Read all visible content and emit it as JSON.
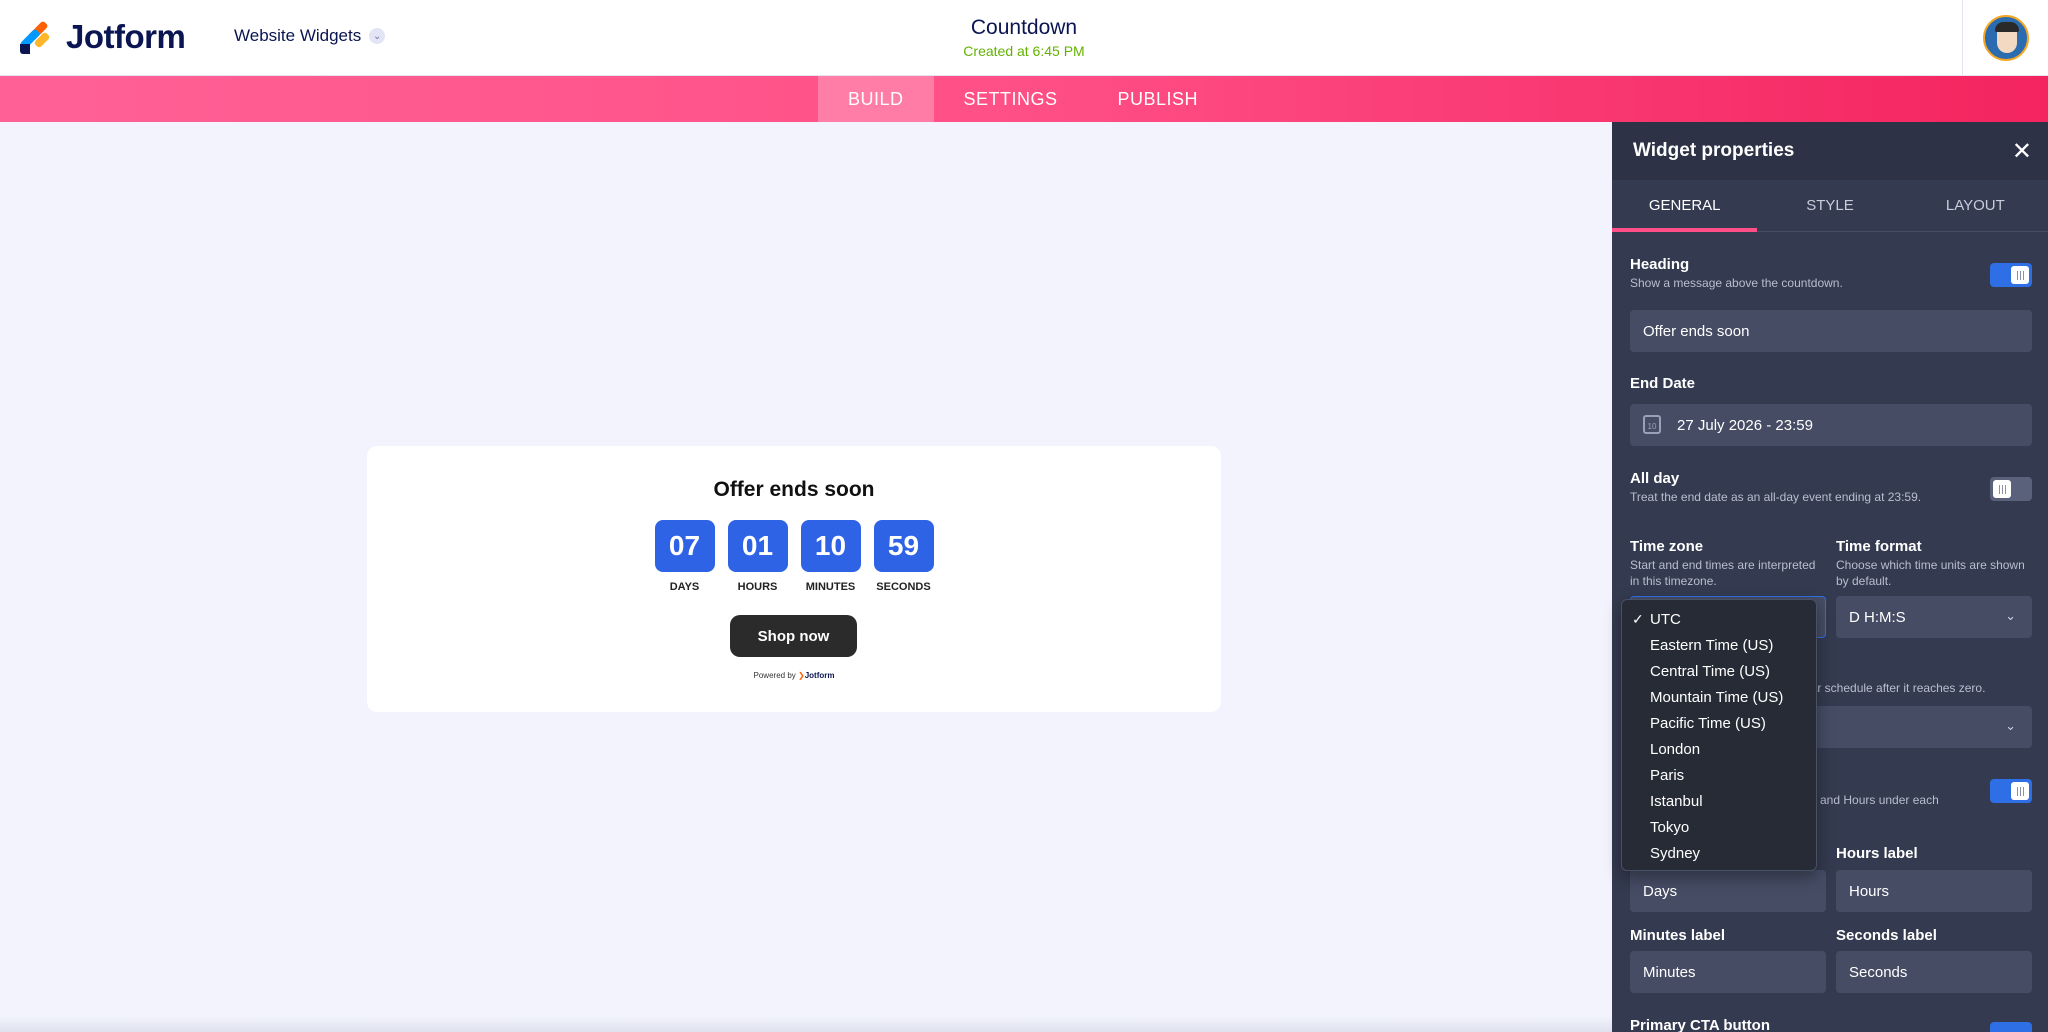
{
  "header": {
    "logo_text": "Jotform",
    "workspace": "Website Widgets",
    "title": "Countdown",
    "subtitle": "Created at 6:45 PM"
  },
  "nav": {
    "tabs": [
      "BUILD",
      "SETTINGS",
      "PUBLISH"
    ],
    "active": "BUILD"
  },
  "widget": {
    "heading": "Offer ends soon",
    "units": [
      {
        "value": "07",
        "label": "DAYS"
      },
      {
        "value": "01",
        "label": "HOURS"
      },
      {
        "value": "10",
        "label": "MINUTES"
      },
      {
        "value": "59",
        "label": "SECONDS"
      }
    ],
    "cta": "Shop now",
    "powered_prefix": "Powered by",
    "powered_brand": "Jotform",
    "accent_color": "#2e63e6"
  },
  "panel": {
    "title": "Widget properties",
    "tabs": [
      "GENERAL",
      "STYLE",
      "LAYOUT"
    ],
    "active_tab": "GENERAL",
    "heading": {
      "label": "Heading",
      "desc": "Show a message above the countdown.",
      "value": "Offer ends soon",
      "toggle": "on"
    },
    "end_date": {
      "label": "End Date",
      "value": "27 July 2026 - 23:59"
    },
    "all_day": {
      "label": "All day",
      "desc": "Treat the end date as an all-day event ending at 23:59.",
      "toggle": "off"
    },
    "time_zone": {
      "label": "Time zone",
      "desc": "Start and end times are interpreted in this timezone."
    },
    "time_format": {
      "label": "Time format",
      "desc": "Choose which time units are shown by default.",
      "value": "D H:M:S"
    },
    "repeat_desc_fragment": "lar schedule after it reaches zero.",
    "labels_desc_fragment": "and Hours under each",
    "days_label": {
      "label": "Days label",
      "value": "Days"
    },
    "hours_label": {
      "label": "Hours label",
      "value": "Hours"
    },
    "minutes_label": {
      "label": "Minutes label",
      "value": "Minutes"
    },
    "seconds_label": {
      "label": "Seconds label",
      "value": "Seconds"
    },
    "primary_cta": {
      "label": "Primary CTA button"
    }
  },
  "timezone_dropdown": {
    "selected": "UTC",
    "options": [
      "UTC",
      "Eastern Time (US)",
      "Central Time (US)",
      "Mountain Time (US)",
      "Pacific Time (US)",
      "London",
      "Paris",
      "Istanbul",
      "Tokyo",
      "Sydney"
    ]
  },
  "icons": {
    "close": "close-icon",
    "calendar": "calendar-icon",
    "chevron": "chevron-down-icon",
    "check": "check-icon"
  }
}
